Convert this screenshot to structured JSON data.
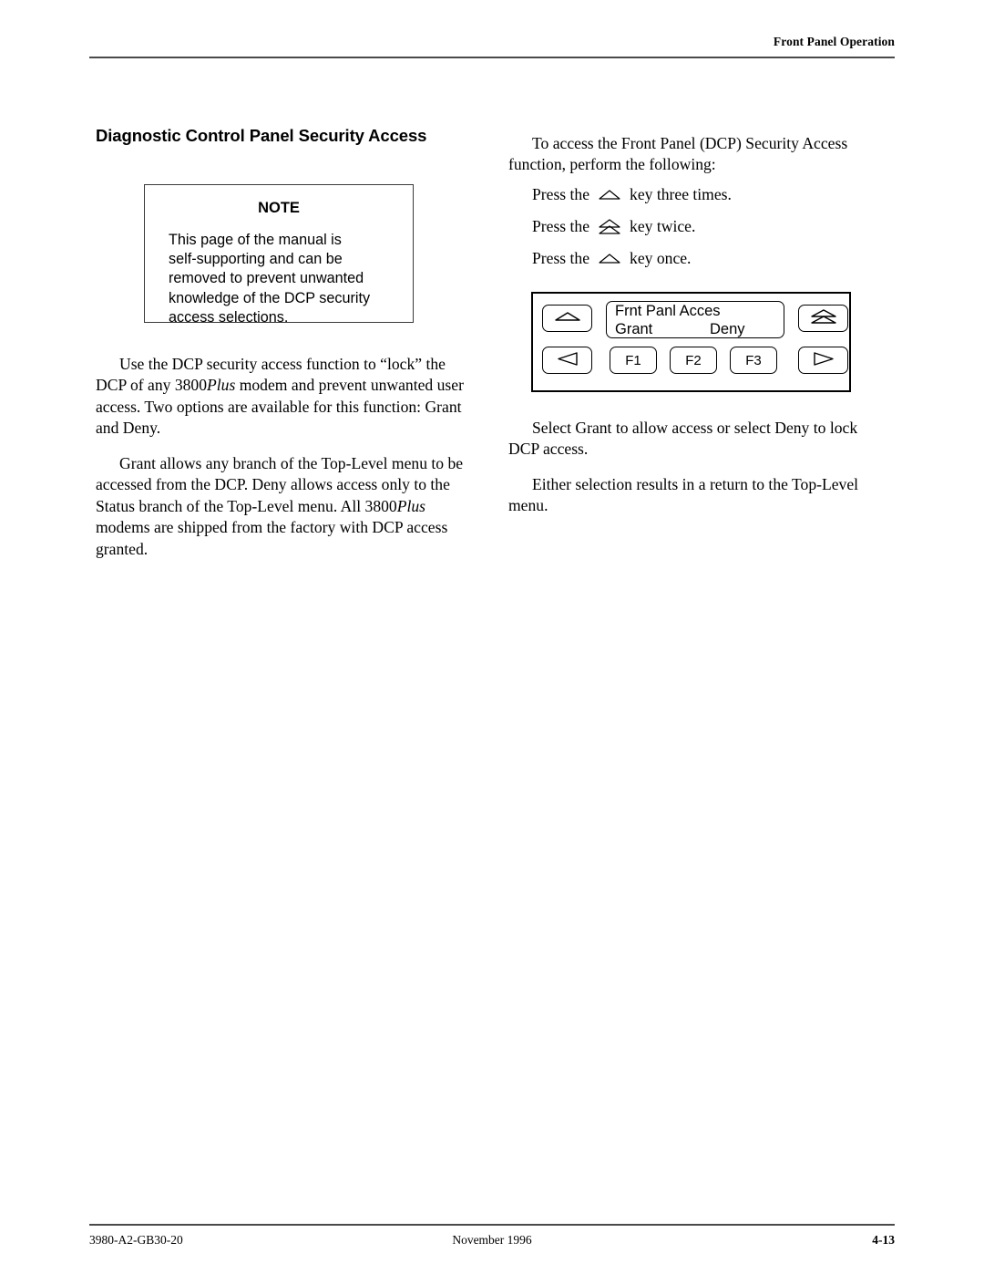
{
  "header": {
    "title": "Front Panel Operation"
  },
  "footer": {
    "doc_number": "3980-A2-GB30-20",
    "date": "November 1996",
    "page_number": "4-13"
  },
  "left_column": {
    "section_heading": "Diagnostic Control Panel Security Access",
    "note": {
      "title": "NOTE",
      "body": "This page of the manual is\nself-supporting and can be\nremoved to prevent unwanted\nknowledge of the DCP security\naccess selections."
    },
    "paragraph_1_part_1": "Use the DCP security access function to “lock” the DCP of any 3800",
    "paragraph_1_italic": "Plus",
    "paragraph_1_part_2": " modem and prevent unwanted user access. Two options are available for this function: Grant and Deny.",
    "paragraph_2_part_1": "Grant allows any branch of the Top-Level menu to be accessed from the DCP. Deny allows access only to the Status branch of the Top-Level menu. All 3800",
    "paragraph_2_italic": "Plus",
    "paragraph_2_part_2": " modems are shipped from the factory with DCP access granted."
  },
  "right_column": {
    "intro_paragraph": "To access the Front Panel (DCP) Security Access function, perform the following:",
    "press_steps": [
      {
        "prefix": "Press the",
        "key_icon": "up-arrow-key-icon",
        "suffix": "key three times."
      },
      {
        "prefix": "Press the",
        "key_icon": "double-up-arrow-key-icon",
        "suffix": "key twice."
      },
      {
        "prefix": "Press the",
        "key_icon": "up-arrow-key-icon",
        "suffix": "key once."
      }
    ],
    "panel": {
      "lcd_line_1": "Frnt Panl Acces",
      "lcd_option_left": "Grant",
      "lcd_option_right": "Deny",
      "buttons": {
        "up": "up-arrow-icon",
        "double_up": "double-up-arrow-icon",
        "left": "left-arrow-icon",
        "right": "right-arrow-icon",
        "f1": "F1",
        "f2": "F2",
        "f3": "F3"
      }
    },
    "paragraph_select": "Select Grant to allow access or select Deny to lock DCP access.",
    "paragraph_either": "Either selection results in a return to the Top-Level menu."
  },
  "colors": {
    "text": "#000000",
    "rule": "#4a4a4a",
    "page_background": "#ffffff"
  }
}
